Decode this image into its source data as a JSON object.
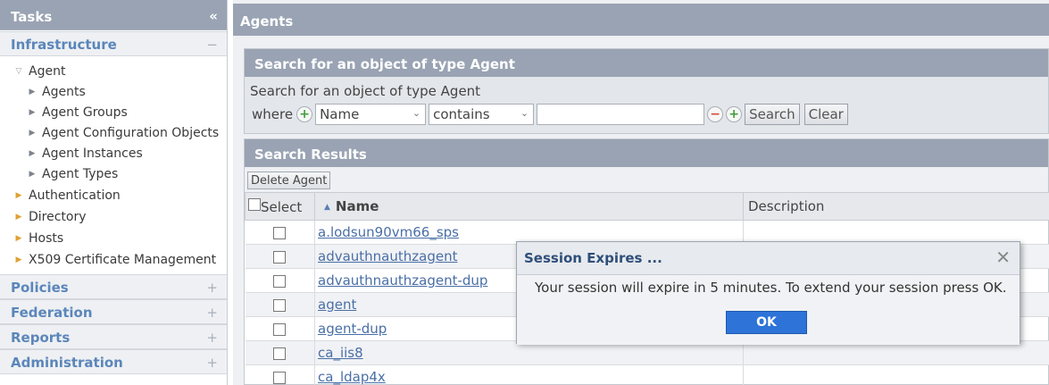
{
  "sidebar": {
    "title": "Tasks",
    "collapse_icon": "«",
    "infrastructure": {
      "label": "Infrastructure",
      "toggle": "−",
      "tree": {
        "agent": "Agent",
        "agent_children": [
          "Agents",
          "Agent Groups",
          "Agent Configuration Objects",
          "Agent Instances",
          "Agent Types"
        ],
        "others": [
          "Authentication",
          "Directory",
          "Hosts",
          "X509 Certificate Management"
        ]
      }
    },
    "sections": [
      {
        "label": "Policies",
        "toggle": "+"
      },
      {
        "label": "Federation",
        "toggle": "+"
      },
      {
        "label": "Reports",
        "toggle": "+"
      },
      {
        "label": "Administration",
        "toggle": "+"
      }
    ]
  },
  "main": {
    "title": "Agents",
    "search": {
      "panel_title": "Search for an object of type Agent",
      "subtitle": "Search for an object of type Agent",
      "where_label": "where",
      "field_value": "Name",
      "operator_value": "contains",
      "text_value": "",
      "search_button": "Search",
      "clear_button": "Clear"
    },
    "results": {
      "panel_title": "Search Results",
      "delete_button": "Delete Agent",
      "columns": {
        "select": "Select",
        "name": "Name",
        "description": "Description"
      },
      "rows": [
        {
          "name": "a.lodsun90vm66_sps",
          "description": ""
        },
        {
          "name": "advauthnauthzagent",
          "description": ""
        },
        {
          "name": "advauthnauthzagent-dup",
          "description": ""
        },
        {
          "name": "agent",
          "description": ""
        },
        {
          "name": "agent-dup",
          "description": ""
        },
        {
          "name": "ca_iis8",
          "description": ""
        },
        {
          "name": "ca_ldap4x",
          "description": ""
        }
      ]
    }
  },
  "modal": {
    "title": "Session Expires ...",
    "message": "Your session will expire in 5 minutes. To extend your session press OK.",
    "ok_button": "OK",
    "close_icon": "✕"
  },
  "colors": {
    "header_bg": "#99a3b3",
    "accent_link": "#5b86ba",
    "ok_button_bg": "#2d73d8",
    "tree_arrow_orange": "#e0a030"
  }
}
